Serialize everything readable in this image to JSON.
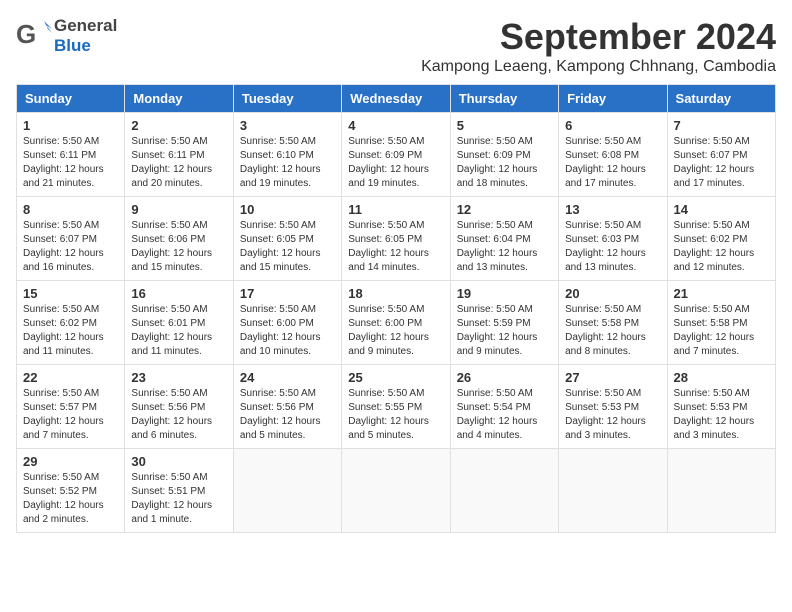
{
  "header": {
    "logo_general": "General",
    "logo_blue": "Blue",
    "month_title": "September 2024",
    "location": "Kampong Leaeng, Kampong Chhnang, Cambodia"
  },
  "calendar": {
    "columns": [
      "Sunday",
      "Monday",
      "Tuesday",
      "Wednesday",
      "Thursday",
      "Friday",
      "Saturday"
    ],
    "weeks": [
      [
        {
          "day": "",
          "info": ""
        },
        {
          "day": "2",
          "info": "Sunrise: 5:50 AM\nSunset: 6:11 PM\nDaylight: 12 hours\nand 20 minutes."
        },
        {
          "day": "3",
          "info": "Sunrise: 5:50 AM\nSunset: 6:10 PM\nDaylight: 12 hours\nand 19 minutes."
        },
        {
          "day": "4",
          "info": "Sunrise: 5:50 AM\nSunset: 6:09 PM\nDaylight: 12 hours\nand 19 minutes."
        },
        {
          "day": "5",
          "info": "Sunrise: 5:50 AM\nSunset: 6:09 PM\nDaylight: 12 hours\nand 18 minutes."
        },
        {
          "day": "6",
          "info": "Sunrise: 5:50 AM\nSunset: 6:08 PM\nDaylight: 12 hours\nand 17 minutes."
        },
        {
          "day": "7",
          "info": "Sunrise: 5:50 AM\nSunset: 6:07 PM\nDaylight: 12 hours\nand 17 minutes."
        }
      ],
      [
        {
          "day": "8",
          "info": "Sunrise: 5:50 AM\nSunset: 6:07 PM\nDaylight: 12 hours\nand 16 minutes."
        },
        {
          "day": "9",
          "info": "Sunrise: 5:50 AM\nSunset: 6:06 PM\nDaylight: 12 hours\nand 15 minutes."
        },
        {
          "day": "10",
          "info": "Sunrise: 5:50 AM\nSunset: 6:05 PM\nDaylight: 12 hours\nand 15 minutes."
        },
        {
          "day": "11",
          "info": "Sunrise: 5:50 AM\nSunset: 6:05 PM\nDaylight: 12 hours\nand 14 minutes."
        },
        {
          "day": "12",
          "info": "Sunrise: 5:50 AM\nSunset: 6:04 PM\nDaylight: 12 hours\nand 13 minutes."
        },
        {
          "day": "13",
          "info": "Sunrise: 5:50 AM\nSunset: 6:03 PM\nDaylight: 12 hours\nand 13 minutes."
        },
        {
          "day": "14",
          "info": "Sunrise: 5:50 AM\nSunset: 6:02 PM\nDaylight: 12 hours\nand 12 minutes."
        }
      ],
      [
        {
          "day": "15",
          "info": "Sunrise: 5:50 AM\nSunset: 6:02 PM\nDaylight: 12 hours\nand 11 minutes."
        },
        {
          "day": "16",
          "info": "Sunrise: 5:50 AM\nSunset: 6:01 PM\nDaylight: 12 hours\nand 11 minutes."
        },
        {
          "day": "17",
          "info": "Sunrise: 5:50 AM\nSunset: 6:00 PM\nDaylight: 12 hours\nand 10 minutes."
        },
        {
          "day": "18",
          "info": "Sunrise: 5:50 AM\nSunset: 6:00 PM\nDaylight: 12 hours\nand 9 minutes."
        },
        {
          "day": "19",
          "info": "Sunrise: 5:50 AM\nSunset: 5:59 PM\nDaylight: 12 hours\nand 9 minutes."
        },
        {
          "day": "20",
          "info": "Sunrise: 5:50 AM\nSunset: 5:58 PM\nDaylight: 12 hours\nand 8 minutes."
        },
        {
          "day": "21",
          "info": "Sunrise: 5:50 AM\nSunset: 5:58 PM\nDaylight: 12 hours\nand 7 minutes."
        }
      ],
      [
        {
          "day": "22",
          "info": "Sunrise: 5:50 AM\nSunset: 5:57 PM\nDaylight: 12 hours\nand 7 minutes."
        },
        {
          "day": "23",
          "info": "Sunrise: 5:50 AM\nSunset: 5:56 PM\nDaylight: 12 hours\nand 6 minutes."
        },
        {
          "day": "24",
          "info": "Sunrise: 5:50 AM\nSunset: 5:56 PM\nDaylight: 12 hours\nand 5 minutes."
        },
        {
          "day": "25",
          "info": "Sunrise: 5:50 AM\nSunset: 5:55 PM\nDaylight: 12 hours\nand 5 minutes."
        },
        {
          "day": "26",
          "info": "Sunrise: 5:50 AM\nSunset: 5:54 PM\nDaylight: 12 hours\nand 4 minutes."
        },
        {
          "day": "27",
          "info": "Sunrise: 5:50 AM\nSunset: 5:53 PM\nDaylight: 12 hours\nand 3 minutes."
        },
        {
          "day": "28",
          "info": "Sunrise: 5:50 AM\nSunset: 5:53 PM\nDaylight: 12 hours\nand 3 minutes."
        }
      ],
      [
        {
          "day": "29",
          "info": "Sunrise: 5:50 AM\nSunset: 5:52 PM\nDaylight: 12 hours\nand 2 minutes."
        },
        {
          "day": "30",
          "info": "Sunrise: 5:50 AM\nSunset: 5:51 PM\nDaylight: 12 hours\nand 1 minute."
        },
        {
          "day": "",
          "info": ""
        },
        {
          "day": "",
          "info": ""
        },
        {
          "day": "",
          "info": ""
        },
        {
          "day": "",
          "info": ""
        },
        {
          "day": "",
          "info": ""
        }
      ]
    ],
    "first_week_special": {
      "day": "1",
      "info": "Sunrise: 5:50 AM\nSunset: 6:11 PM\nDaylight: 12 hours\nand 21 minutes."
    }
  }
}
